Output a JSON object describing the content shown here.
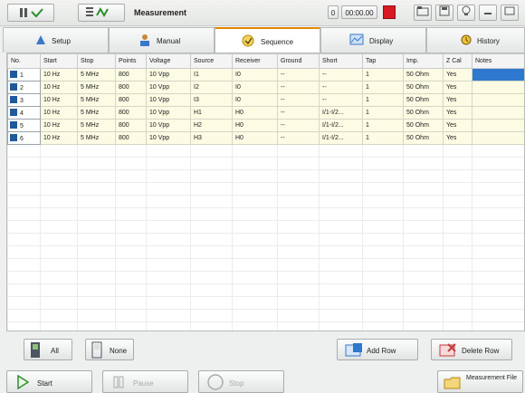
{
  "titlebar": {
    "title": "Measurement",
    "counter": "0",
    "timer": "00:00.00"
  },
  "tabs": [
    {
      "label": "Setup",
      "icon": "setup-icon"
    },
    {
      "label": "Manual",
      "icon": "manual-icon"
    },
    {
      "label": "Sequence",
      "icon": "sequence-icon"
    },
    {
      "label": "Display",
      "icon": "display-icon"
    },
    {
      "label": "History",
      "icon": "history-icon"
    }
  ],
  "table": {
    "columns": [
      "No.",
      "Start",
      "Stop",
      "Points",
      "Voltage",
      "Source",
      "Receiver",
      "Ground",
      "Short",
      "Tap",
      "Imp.",
      "Z Cal",
      "Notes"
    ],
    "rows": [
      [
        "1",
        "10 Hz",
        "5 MHz",
        "800",
        "10 Vpp",
        "I1",
        "I0",
        "--",
        "--",
        "1",
        "50 Ohm",
        "Yes",
        ""
      ],
      [
        "2",
        "10 Hz",
        "5 MHz",
        "800",
        "10 Vpp",
        "I2",
        "I0",
        "--",
        "--",
        "1",
        "50 Ohm",
        "Yes",
        ""
      ],
      [
        "3",
        "10 Hz",
        "5 MHz",
        "800",
        "10 Vpp",
        "I3",
        "I0",
        "--",
        "--",
        "1",
        "50 Ohm",
        "Yes",
        ""
      ],
      [
        "4",
        "10 Hz",
        "5 MHz",
        "800",
        "10 Vpp",
        "H1",
        "H0",
        "--",
        "I/1-I/2...",
        "1",
        "50 Ohm",
        "Yes",
        ""
      ],
      [
        "5",
        "10 Hz",
        "5 MHz",
        "800",
        "10 Vpp",
        "H2",
        "H0",
        "--",
        "I/1-I/2...",
        "1",
        "50 Ohm",
        "Yes",
        ""
      ],
      [
        "6",
        "10 Hz",
        "5 MHz",
        "800",
        "10 Vpp",
        "H3",
        "H0",
        "--",
        "I/1-I/2...",
        "1",
        "50 Ohm",
        "Yes",
        ""
      ]
    ]
  },
  "actions": {
    "all": "All",
    "none": "None",
    "add_row": "Add Row",
    "delete_row": "Delete Row"
  },
  "bottom": {
    "start": "Start",
    "pause": "Pause",
    "stop": "Stop",
    "measurement_file": "Measurement File"
  },
  "colors": {
    "accent_tab": "#e08a00",
    "row_cell": "#fcfbe4",
    "selection": "#2f78d0",
    "record": "#d91a22"
  }
}
